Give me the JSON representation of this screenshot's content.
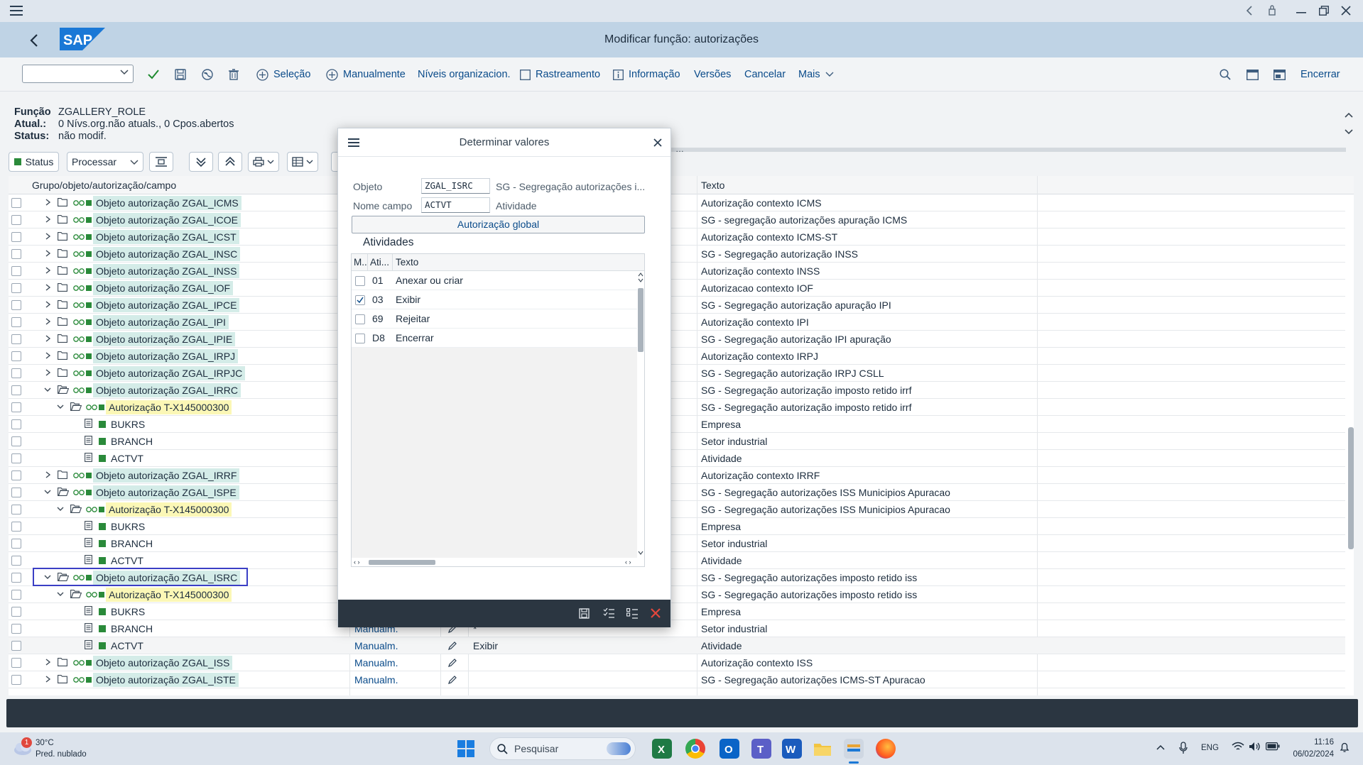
{
  "window": {
    "title": "Modificar função: autorizações"
  },
  "toolbar": {
    "selecao": "Seleção",
    "manualmente": "Manualmente",
    "niveis": "Níveis organizacion.",
    "rastreamento": "Rastreamento",
    "informacao": "Informação",
    "versoes": "Versões",
    "cancelar": "Cancelar",
    "mais": "Mais",
    "encerrar": "Encerrar"
  },
  "header": {
    "funcao_label": "Função",
    "funcao_value": "ZGALLERY_ROLE",
    "atual_label": "Atual.:",
    "atual_value": "0 Nívs.org.não atuals., 0 Cpos.abertos",
    "status_label": "Status:",
    "status_value": "não modif."
  },
  "tree_toolbar": {
    "status": "Status",
    "processar": "Processar"
  },
  "grid": {
    "col_tree": "Grupo/objeto/autorização/campo",
    "col_texto": "Texto",
    "rows": [
      {
        "t": "obj",
        "label": "Objeto autorização ZGAL_ICMS",
        "text": "Autorização contexto ICMS"
      },
      {
        "t": "obj",
        "label": "Objeto autorização ZGAL_ICOE",
        "text": "SG - segregação autorizações apuração ICMS"
      },
      {
        "t": "obj",
        "label": "Objeto autorização ZGAL_ICST",
        "text": "Autorização contexto ICMS-ST"
      },
      {
        "t": "obj",
        "label": "Objeto autorização ZGAL_INSC",
        "text": "SG - Segregação autorização INSS"
      },
      {
        "t": "obj",
        "label": "Objeto autorização ZGAL_INSS",
        "text": "Autorização contexto INSS"
      },
      {
        "t": "obj",
        "label": "Objeto autorização ZGAL_IOF",
        "text": "Autorizacao contexto IOF"
      },
      {
        "t": "obj",
        "label": "Objeto autorização ZGAL_IPCE",
        "text": "SG - Segregação autorização apuração IPI"
      },
      {
        "t": "obj",
        "label": "Objeto autorização ZGAL_IPI",
        "text": "Autorização contexto IPI"
      },
      {
        "t": "obj",
        "label": "Objeto autorização ZGAL_IPIE",
        "text": "SG - Segregação autorização IPI apuração"
      },
      {
        "t": "obj",
        "label": "Objeto autorização ZGAL_IRPJ",
        "text": "Autorização contexto IRPJ"
      },
      {
        "t": "obj",
        "label": "Objeto autorização ZGAL_IRPJC",
        "text": "SG - Segregação autorização IRPJ CSLL"
      },
      {
        "t": "objo",
        "label": "Objeto autorização ZGAL_IRRC",
        "text": "SG - Segregação autorização imposto retido irrf"
      },
      {
        "t": "aut",
        "label": "Autorização T-X145000300",
        "text": "SG - Segregação autorização imposto retido irrf"
      },
      {
        "t": "fld",
        "label": "BUKRS",
        "text": "Empresa"
      },
      {
        "t": "fld",
        "label": "BRANCH",
        "text": "Setor industrial"
      },
      {
        "t": "fld",
        "label": "ACTVT",
        "text": "Atividade"
      },
      {
        "t": "obj",
        "label": "Objeto autorização ZGAL_IRRF",
        "text": "Autorização contexto IRRF"
      },
      {
        "t": "objo",
        "label": "Objeto autorização ZGAL_ISPE",
        "text": "SG - Segregação autorizações ISS Municipios Apuracao"
      },
      {
        "t": "aut",
        "label": "Autorização T-X145000300",
        "text": "SG - Segregação autorizações ISS Municipios Apuracao"
      },
      {
        "t": "fld",
        "label": "BUKRS",
        "text": "Empresa"
      },
      {
        "t": "fld",
        "label": "BRANCH",
        "text": "Setor industrial"
      },
      {
        "t": "fld",
        "label": "ACTVT",
        "text": "Atividade"
      },
      {
        "t": "objo",
        "label": "Objeto autorização ZGAL_ISRC",
        "text": "SG - Segregação autorizações imposto retido iss"
      },
      {
        "t": "aut",
        "label": "Autorização T-X145000300",
        "text": "SG - Segregação autorizações imposto retido iss"
      },
      {
        "t": "fld",
        "label": "BUKRS",
        "text": "Empresa"
      },
      {
        "t": "fld",
        "label": "BRANCH",
        "text": "Setor industrial",
        "maint": "Manualm.",
        "pen": true,
        "val": "*"
      },
      {
        "t": "fld",
        "label": "ACTVT",
        "text": "Atividade",
        "maint": "Manualm.",
        "pen": true,
        "val": "Exibir"
      },
      {
        "t": "obj",
        "label": "Objeto autorização ZGAL_ISS",
        "text": "Autorização contexto ISS",
        "maint": "Manualm.",
        "pen": true
      },
      {
        "t": "obj",
        "label": "Objeto autorização ZGAL_ISTE",
        "text": "SG - Segregação autorizações ICMS-ST Apuracao",
        "maint": "Manualm.",
        "pen": true
      }
    ]
  },
  "dialog": {
    "title": "Determinar valores",
    "objeto_label": "Objeto",
    "objeto_value": "ZGAL_ISRC",
    "objeto_desc": "SG - Segregação autorizações i...",
    "campo_label": "Nome campo",
    "campo_value": "ACTVT",
    "campo_desc": "Atividade",
    "global_button": "Autorização global",
    "atividades_title": "Atividades",
    "col_m": "M..",
    "col_ati": "Ati...",
    "col_texto": "Texto",
    "activities": [
      {
        "code": "01",
        "text": "Anexar ou criar",
        "checked": false
      },
      {
        "code": "03",
        "text": "Exibir",
        "checked": true
      },
      {
        "code": "69",
        "text": "Rejeitar",
        "checked": false
      },
      {
        "code": "D8",
        "text": "Encerrar",
        "checked": false
      }
    ]
  },
  "taskbar": {
    "weather_temp": "30°C",
    "weather_desc": "Pred. nublado",
    "weather_badge": "1",
    "search": "Pesquisar",
    "lang": "ENG",
    "time": "11:16",
    "date": "06/02/2024"
  },
  "colors": {
    "shell": "#bfd3e5",
    "accent": "#0a6ed1",
    "object_bg": "#d4ece8",
    "auth_bg": "#fbf7b6",
    "highlight": "#3b3fc5"
  }
}
